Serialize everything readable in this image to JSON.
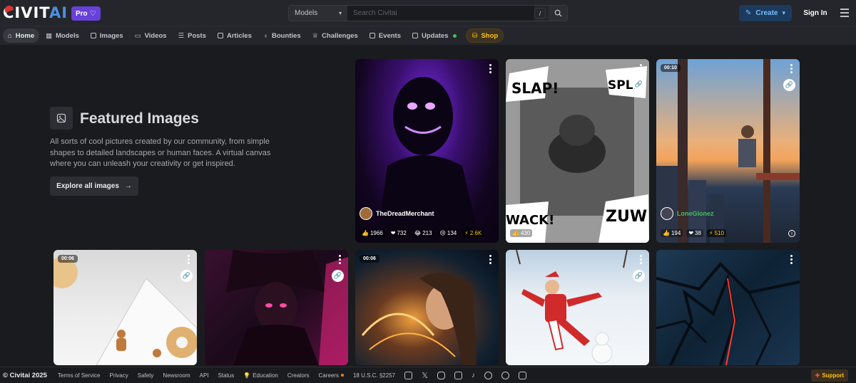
{
  "brand": {
    "logo_main": "CIVIT",
    "logo_accent": "AI",
    "pro_badge": "Pro"
  },
  "search": {
    "category": "Models",
    "placeholder": "Search Civitai",
    "shortcut": "/"
  },
  "header": {
    "create_label": "Create",
    "signin_label": "Sign In"
  },
  "nav": [
    {
      "label": "Home",
      "icon": "home-icon",
      "active": true
    },
    {
      "label": "Models",
      "icon": "grid-icon"
    },
    {
      "label": "Images",
      "icon": "image-icon"
    },
    {
      "label": "Videos",
      "icon": "video-icon"
    },
    {
      "label": "Posts",
      "icon": "posts-icon"
    },
    {
      "label": "Articles",
      "icon": "article-icon"
    },
    {
      "label": "Bounties",
      "icon": "moneybag-icon"
    },
    {
      "label": "Challenges",
      "icon": "trophy-icon"
    },
    {
      "label": "Events",
      "icon": "calendar-icon"
    },
    {
      "label": "Updates",
      "icon": "updates-icon"
    },
    {
      "label": "Shop",
      "icon": "shop-icon"
    }
  ],
  "featured": {
    "title": "Featured Images",
    "description": "All sorts of cool pictures created by our community, from simple shapes to detailed landscapes or human faces. A virtual canvas where you can unleash your creativity or get inspired.",
    "button": "Explore all images"
  },
  "cards_top": [
    {
      "user": "TheDreadMerchant",
      "likes": "1966",
      "hearts": "732",
      "laugh": "213",
      "cry": "134",
      "buzz": "2.6K"
    },
    {
      "user": "",
      "likes": "430",
      "hearts": "",
      "laugh": "",
      "cry": "",
      "buzz": ""
    },
    {
      "user": "LoneGlonez",
      "duration": "00:10",
      "likes": "194",
      "hearts": "38",
      "laugh": "",
      "cry": "",
      "buzz": "510"
    }
  ],
  "cards_bottom": [
    {
      "duration": "00:06"
    },
    {
      "duration": ""
    },
    {
      "duration": "00:06"
    },
    {
      "duration": ""
    },
    {
      "duration": ""
    }
  ],
  "footer": {
    "copyright": "© Civitai 2025",
    "links": [
      "Terms of Service",
      "Privacy",
      "Safety",
      "Newsroom",
      "API",
      "Status",
      "Education",
      "Creators",
      "Careers",
      "18 U.S.C. §2257"
    ],
    "support": "Support"
  },
  "colors": {
    "accent": "#4a90e2",
    "pro": "#6741d9",
    "shop": "#fcc419",
    "updates_dot": "#40c057"
  }
}
